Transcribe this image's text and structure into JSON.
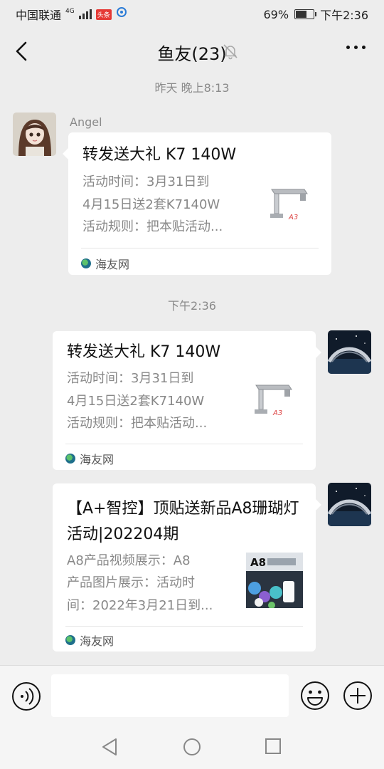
{
  "status_bar": {
    "carrier": "中国联通",
    "network": "4G",
    "tag": "头条",
    "battery": "69%",
    "battery_level": 0.69,
    "time": "下午2:36"
  },
  "header": {
    "title": "鱼友(23)",
    "icons": {
      "back": "chevron-left-icon",
      "mute": "bell-muted-icon",
      "more": "more-dots-icon"
    }
  },
  "messages": {
    "timestamp_1": "昨天 晚上8:13",
    "timestamp_2": "下午2:36",
    "msg1": {
      "sender": "Angel",
      "title": "转发送大礼 K7 140W",
      "desc_lines": [
        "活动时间：3月31日到",
        "4月15日送2套K7140W",
        "活动规则：把本贴活动..."
      ],
      "source": "海友网"
    },
    "msg2": {
      "title": "转发送大礼 K7 140W",
      "desc_lines": [
        "活动时间：3月31日到",
        "4月15日送2套K7140W",
        "活动规则：把本贴活动..."
      ],
      "source": "海友网"
    },
    "msg3": {
      "title": "【A+智控】顶贴送新品A8珊瑚灯活动|202204期",
      "desc_lines": [
        "A8产品视频展示：A8",
        "产品图片展示：活动时",
        "间：2022年3月21日到..."
      ],
      "thumb_label": "A8",
      "source": "海友网"
    }
  },
  "input": {
    "placeholder": ""
  },
  "colors": {
    "background": "#ededed",
    "card": "#ffffff",
    "meta_text": "#8a8a8a"
  }
}
